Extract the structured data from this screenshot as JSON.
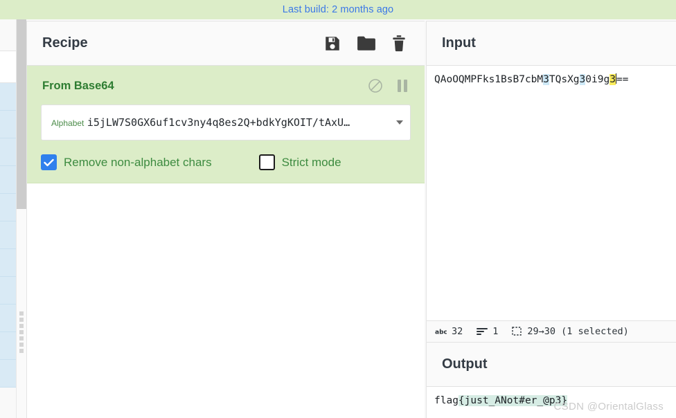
{
  "banner": {
    "text": "Last build: 2 months ago",
    "color": "#3b78e7",
    "background": "#dcedc8"
  },
  "recipe": {
    "title": "Recipe",
    "icons": [
      {
        "name": "save-icon",
        "label": "Save recipe"
      },
      {
        "name": "folder-icon",
        "label": "Load recipe"
      },
      {
        "name": "trash-icon",
        "label": "Clear recipe"
      }
    ],
    "operations": [
      {
        "name": "From Base64",
        "accent": "#2e7d32",
        "background": "#dcedc8",
        "icons": [
          {
            "name": "disable-icon",
            "label": "Disable operation"
          },
          {
            "name": "pause-icon",
            "label": "Set breakpoint"
          }
        ],
        "args": [
          {
            "type": "select",
            "label": "Alphabet",
            "value": "i5jLW7S0GX6uf1cv3ny4q8es2Q+bdkYgKOIT/tAxU…"
          }
        ],
        "checkboxes": [
          {
            "label": "Remove non-alphabet chars",
            "checked": true
          },
          {
            "label": "Strict mode",
            "checked": false
          }
        ]
      }
    ]
  },
  "input": {
    "title": "Input",
    "text": "QAoOQMPFks1BsB7cbM3TQsXg30i9g3==",
    "segments": [
      {
        "text": "QAoOQMPFks1BsB7cbM",
        "highlight": "none"
      },
      {
        "text": "3",
        "highlight": "blue"
      },
      {
        "text": "TQsXg",
        "highlight": "none"
      },
      {
        "text": "3",
        "highlight": "blue"
      },
      {
        "text": "0i9g",
        "highlight": "none"
      },
      {
        "text": "3",
        "highlight": "yellow"
      },
      {
        "text": "==",
        "highlight": "none"
      }
    ],
    "status": {
      "length_label": "32",
      "lines_label": "1",
      "selection_label": "29→30 (1 selected)"
    }
  },
  "output": {
    "title": "Output",
    "text": "flag{just_ANot#er_@p3}",
    "segments": [
      {
        "text": "flag",
        "highlight": "none"
      },
      {
        "text": "{just_ANot#er_@p3}",
        "highlight": "teal"
      }
    ]
  },
  "watermark": {
    "text": "CSDN @OrientalGlass"
  },
  "colors": {
    "accent_green": "#2e7d32",
    "operation_bg": "#dcedc8",
    "checkbox_on": "#2f80ed",
    "highlight_blue": "#cde8f6",
    "highlight_yellow": "#fbec5d",
    "highlight_teal": "#d6ece4"
  }
}
